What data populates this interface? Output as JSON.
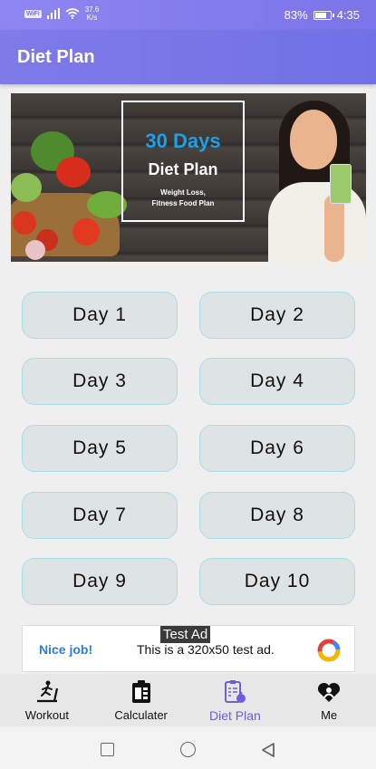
{
  "status_bar": {
    "wifi_badge": "WiFi",
    "speed_value": "37.6",
    "speed_unit": "K/s",
    "battery_percent": "83%",
    "battery_level": 0.83,
    "time": "4:35"
  },
  "app_bar": {
    "title": "Diet Plan"
  },
  "banner": {
    "headline": "30 Days",
    "title": "Diet Plan",
    "subtitle_line1": "Weight Loss,",
    "subtitle_line2": "Fitness Food Plan"
  },
  "days": [
    {
      "label": "Day 1"
    },
    {
      "label": "Day 2"
    },
    {
      "label": "Day 3"
    },
    {
      "label": "Day 4"
    },
    {
      "label": "Day 5"
    },
    {
      "label": "Day 6"
    },
    {
      "label": "Day 7"
    },
    {
      "label": "Day 8"
    },
    {
      "label": "Day 9"
    },
    {
      "label": "Day 10"
    }
  ],
  "ad": {
    "label": "Test Ad",
    "nice_job": "Nice job!",
    "text": "This is a 320x50 test ad."
  },
  "bottom_nav": [
    {
      "label": "Workout",
      "icon": "treadmill-icon"
    },
    {
      "label": "Calculater",
      "icon": "calculator-icon"
    },
    {
      "label": "Diet Plan",
      "icon": "diet-plan-icon",
      "active": true
    },
    {
      "label": "Me",
      "icon": "heart-person-icon"
    }
  ],
  "colors": {
    "accent": "#7a74ea",
    "active_tab": "#6d5fd4",
    "day_button_bg": "#dee3e4",
    "day_button_border": "#a9dce6"
  }
}
